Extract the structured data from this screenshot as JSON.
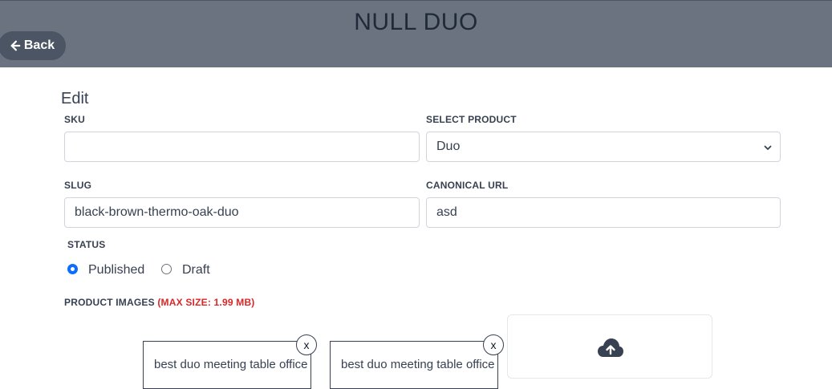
{
  "header": {
    "title": "NULL DUO",
    "back_label": "Back"
  },
  "form": {
    "title": "Edit",
    "sku": {
      "label": "SKU",
      "value": ""
    },
    "product": {
      "label": "SELECT PRODUCT",
      "selected": "Duo"
    },
    "slug": {
      "label": "SLUG",
      "value": "black-brown-thermo-oak-duo"
    },
    "canonical": {
      "label": "CANONICAL URL",
      "value": "asd"
    },
    "status": {
      "label": "STATUS",
      "options": [
        {
          "label": "Published",
          "checked": true
        },
        {
          "label": "Draft",
          "checked": false
        }
      ]
    },
    "images": {
      "label": "PRODUCT IMAGES",
      "max_size": "(MAX SIZE: 1.99 MB)",
      "items": [
        {
          "alt": "best duo meeting table office",
          "remove_label": "x"
        },
        {
          "alt": "best duo meeting table office",
          "remove_label": "x"
        }
      ]
    }
  },
  "icons": {
    "back": "arrow-left-icon",
    "chevron": "chevron-down-icon",
    "upload": "cloud-upload-icon"
  },
  "colors": {
    "header_bg": "#6b7280",
    "back_btn_bg": "#4b5563",
    "radio_checked": "#0d6efd",
    "warning_text": "#dc2626"
  }
}
